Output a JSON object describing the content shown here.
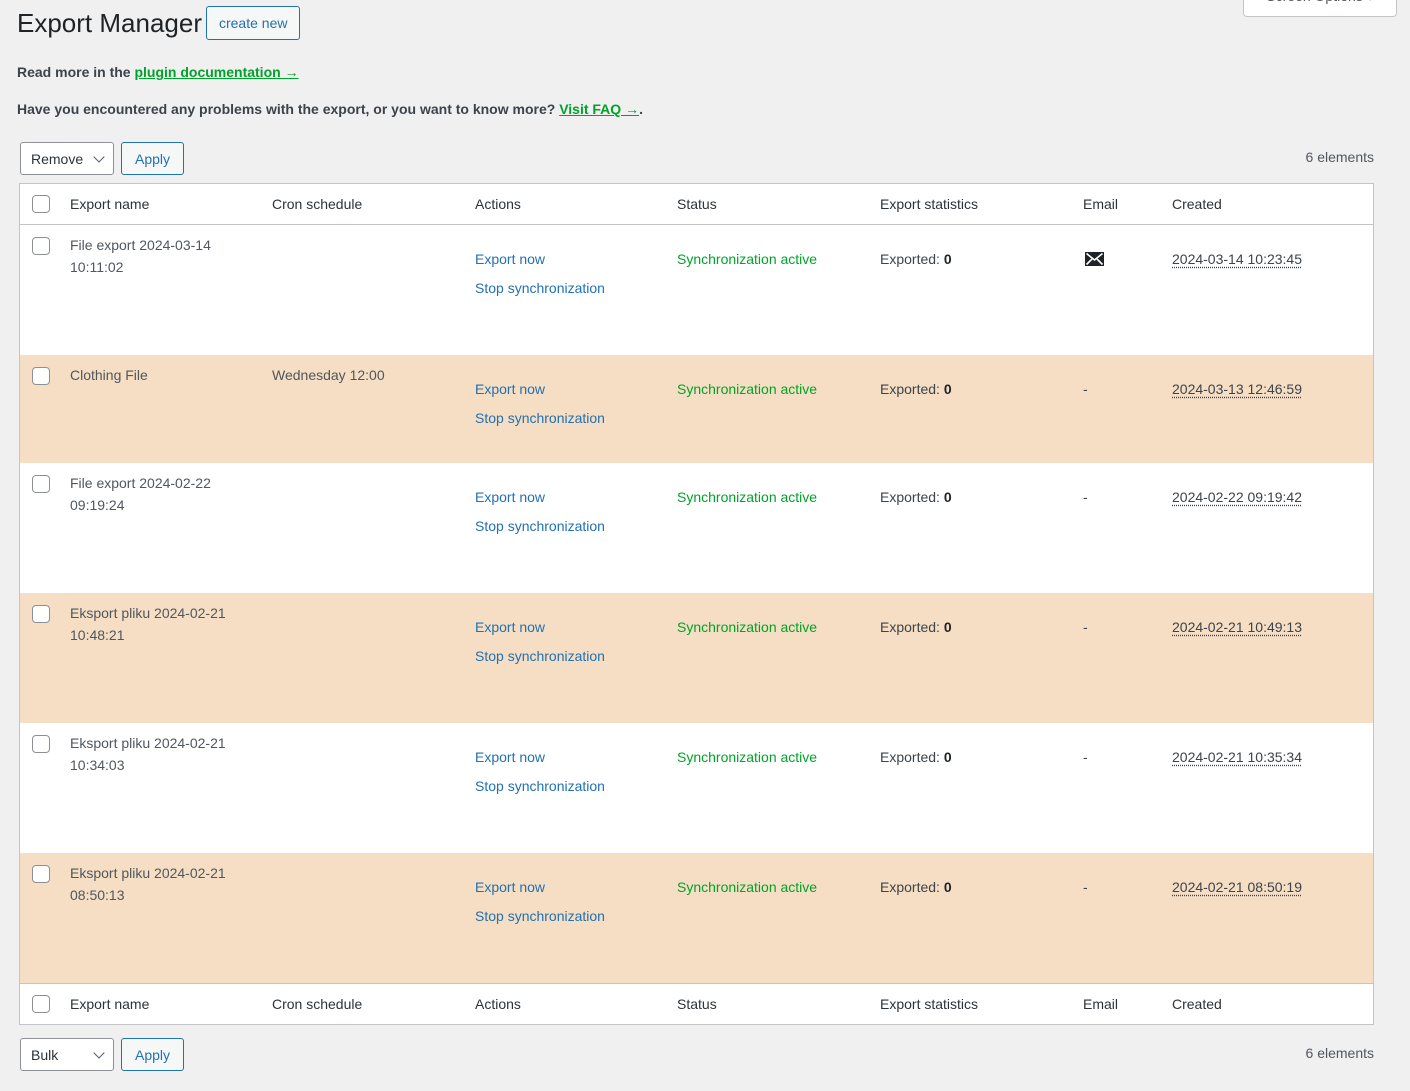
{
  "screen_options": {
    "label": "Screen Options"
  },
  "header": {
    "title": "Export Manager",
    "create_new": "create new"
  },
  "info": {
    "line1_prefix": "Read more in the ",
    "line1_link": "plugin documentation →",
    "line2_prefix": "Have you encountered any problems with the export, or you want to know more? ",
    "line2_link": "Visit FAQ →",
    "line2_suffix": "."
  },
  "colors": {
    "accent": "#2271b1",
    "success": "#00a32a",
    "row_highlight": "#f5dec3",
    "background": "#f0f0f1"
  },
  "tablenav_top": {
    "bulk_select": "Remove",
    "apply": "Apply",
    "count": "6 elements"
  },
  "tablenav_bottom": {
    "bulk_select": "Bulk",
    "apply": "Apply",
    "count": "6 elements"
  },
  "columns": [
    "Export name",
    "Cron schedule",
    "Actions",
    "Status",
    "Export statistics",
    "Email",
    "Created"
  ],
  "rows": [
    {
      "name_line1": "File export 2024-03-14",
      "name_line2": "10:11:02",
      "cron": "",
      "action1": "Export now",
      "action2": "Stop synchronization",
      "status": "Synchronization active",
      "stats_label": "Exported: ",
      "stats_value": "0",
      "email": "mail-icon",
      "created": "2024-03-14 10:23:45"
    },
    {
      "name_line1": "Clothing File",
      "name_line2": "",
      "cron": "Wednesday 12:00",
      "action1": "Export now",
      "action2": "Stop synchronization",
      "status": "Synchronization active",
      "stats_label": "Exported: ",
      "stats_value": "0",
      "email": "-",
      "created": "2024-03-13 12:46:59"
    },
    {
      "name_line1": "File export 2024-02-22",
      "name_line2": "09:19:24",
      "cron": "",
      "action1": "Export now",
      "action2": "Stop synchronization",
      "status": "Synchronization active",
      "stats_label": "Exported: ",
      "stats_value": "0",
      "email": "-",
      "created": "2024-02-22 09:19:42"
    },
    {
      "name_line1": "Eksport pliku 2024-02-21",
      "name_line2": "10:48:21",
      "cron": "",
      "action1": "Export now",
      "action2": "Stop synchronization",
      "status": "Synchronization active",
      "stats_label": "Exported: ",
      "stats_value": "0",
      "email": "-",
      "created": "2024-02-21 10:49:13"
    },
    {
      "name_line1": "Eksport pliku 2024-02-21",
      "name_line2": "10:34:03",
      "cron": "",
      "action1": "Export now",
      "action2": "Stop synchronization",
      "status": "Synchronization active",
      "stats_label": "Exported: ",
      "stats_value": "0",
      "email": "-",
      "created": "2024-02-21 10:35:34"
    },
    {
      "name_line1": "Eksport pliku 2024-02-21",
      "name_line2": "08:50:13",
      "cron": "",
      "action1": "Export now",
      "action2": "Stop synchronization",
      "status": "Synchronization active",
      "stats_label": "Exported: ",
      "stats_value": "0",
      "email": "-",
      "created": "2024-02-21 08:50:19"
    }
  ]
}
